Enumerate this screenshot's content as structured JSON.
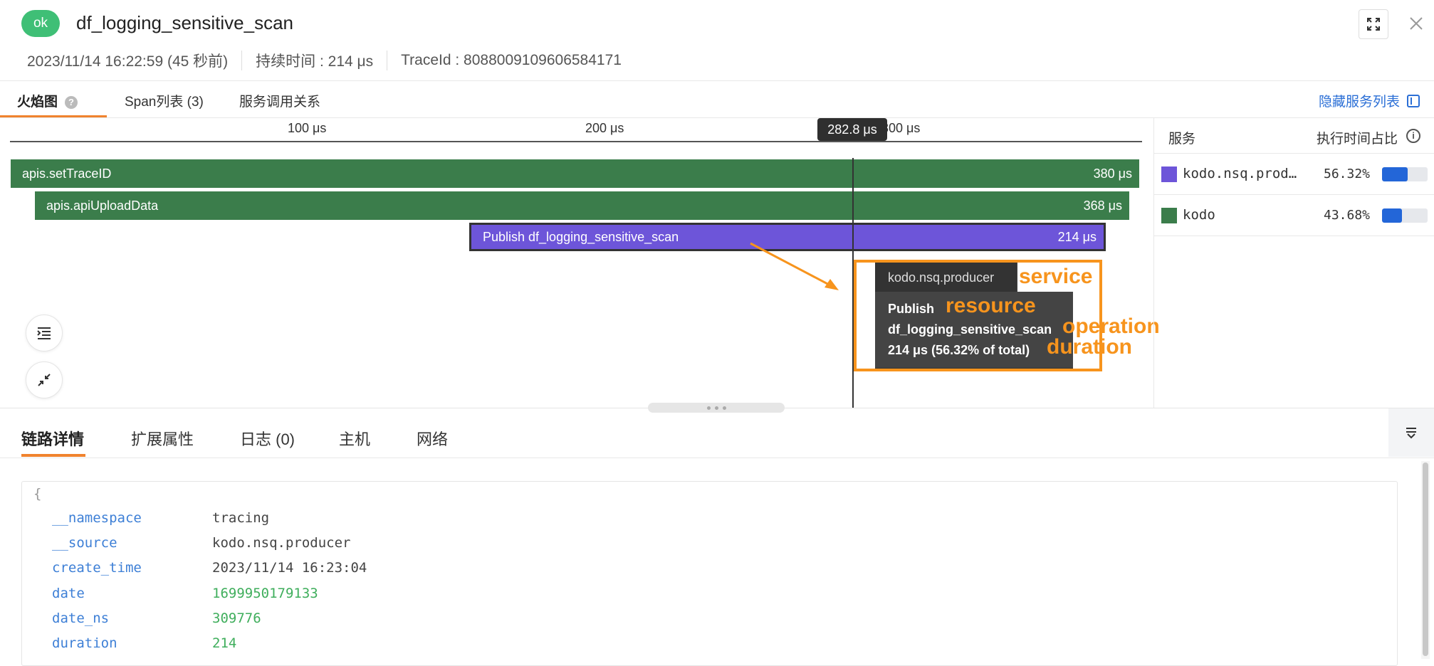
{
  "header": {
    "status": "ok",
    "title": "df_logging_sensitive_scan",
    "timestamp": "2023/11/14 16:22:59 (45 秒前)",
    "duration": "持续时间 : 214 μs",
    "trace_id": "TraceId : 8088009109606584171"
  },
  "top_tabs": {
    "flame": "火焰图",
    "span_list": "Span列表 (3)",
    "service_relation": "服务调用关系",
    "hide_services": "隐藏服务列表"
  },
  "flame": {
    "ticks": [
      "100 μs",
      "200 μs",
      "300 μs"
    ],
    "cursor_value": "282.8 μs",
    "spans": [
      {
        "name": "apis.setTraceID",
        "duration": "380 μs"
      },
      {
        "name": "apis.apiUploadData",
        "duration": "368 μs"
      },
      {
        "name": "Publish df_logging_sensitive_scan",
        "duration": "214 μs"
      }
    ],
    "tooltip": {
      "service": "kodo.nsq.producer",
      "resource": "Publish",
      "operation": "df_logging_sensitive_scan",
      "duration": "214 μs (56.32% of total)"
    },
    "annotations": {
      "service": "service",
      "resource": "resource",
      "operation": "operation",
      "duration": "duration"
    }
  },
  "services": {
    "header_service": "服务",
    "header_ratio": "执行时间占比",
    "rows": [
      {
        "name": "kodo.nsq.prod…",
        "pct": "56.32%",
        "fraction": 0.5632,
        "color": "#6d55d9"
      },
      {
        "name": "kodo",
        "pct": "43.68%",
        "fraction": 0.4368,
        "color": "#3b7d4b"
      }
    ]
  },
  "bottom_tabs": [
    "链路详情",
    "扩展属性",
    "日志 (0)",
    "主机",
    "网络"
  ],
  "details": {
    "open_brace": "{",
    "rows": [
      {
        "key": "__namespace",
        "value": "tracing",
        "type": "str"
      },
      {
        "key": "__source",
        "value": "kodo.nsq.producer",
        "type": "str"
      },
      {
        "key": "create_time",
        "value": "2023/11/14 16:23:04",
        "type": "str"
      },
      {
        "key": "date",
        "value": "1699950179133",
        "type": "num"
      },
      {
        "key": "date_ns",
        "value": "309776",
        "type": "num"
      },
      {
        "key": "duration",
        "value": "214",
        "type": "num"
      }
    ]
  }
}
